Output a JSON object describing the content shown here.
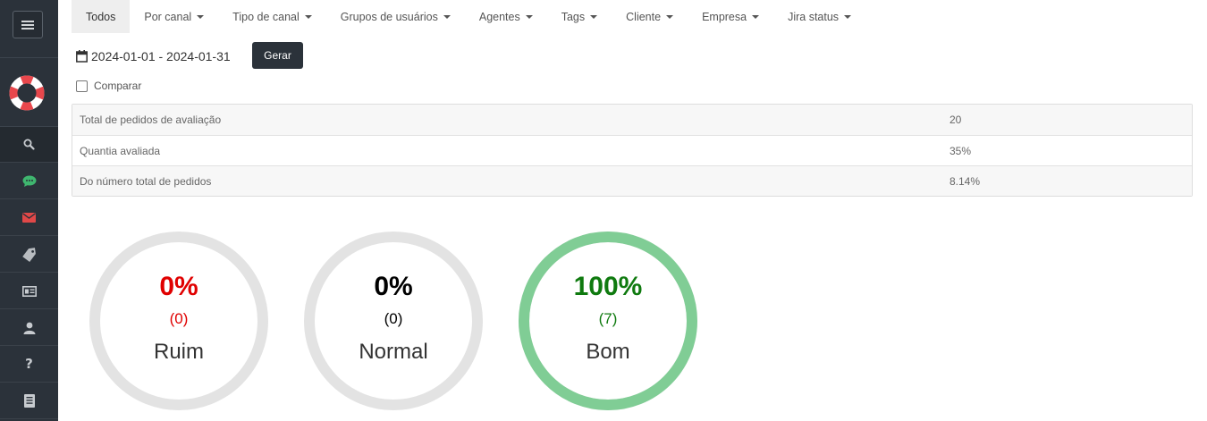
{
  "tabs": [
    {
      "label": "Todos",
      "active": true,
      "dropdown": false
    },
    {
      "label": "Por canal",
      "dropdown": true
    },
    {
      "label": "Tipo de canal",
      "dropdown": true
    },
    {
      "label": "Grupos de usuários",
      "dropdown": true
    },
    {
      "label": "Agentes",
      "dropdown": true
    },
    {
      "label": "Tags",
      "dropdown": true
    },
    {
      "label": "Cliente",
      "dropdown": true
    },
    {
      "label": "Empresa",
      "dropdown": true
    },
    {
      "label": "Jira status",
      "dropdown": true
    }
  ],
  "filter": {
    "date_range": "2024-01-01 - 2024-01-31",
    "generate_label": "Gerar",
    "compare_label": "Comparar",
    "compare_checked": false
  },
  "stats": [
    {
      "label": "Total de pedidos de avaliação",
      "value": "20"
    },
    {
      "label": "Quantia avaliada",
      "value": "35%"
    },
    {
      "label": "Do número total de pedidos",
      "value": "8.14%"
    }
  ],
  "ratings": [
    {
      "percent_text": "0%",
      "count_text": "(0)",
      "label": "Ruim",
      "fraction": 0,
      "text_color": "#e00000"
    },
    {
      "percent_text": "0%",
      "count_text": "(0)",
      "label": "Normal",
      "fraction": 0,
      "text_color": "#000000"
    },
    {
      "percent_text": "100%",
      "count_text": "(7)",
      "label": "Bom",
      "fraction": 1,
      "text_color": "#0f7a0f"
    }
  ],
  "colors": {
    "ring_track": "#e3e3e3",
    "ring_fill_good": "#80cd95",
    "sidebar_bg": "#2b323a",
    "chat_icon": "#3fb66f",
    "mail_icon": "#e04848",
    "logo_red": "#e8474c"
  },
  "sidebar_icons": [
    "menu-icon",
    "lifebuoy-logo",
    "search-icon",
    "chat-icon",
    "mail-icon",
    "tag-icon",
    "id-card-icon",
    "user-icon",
    "question-icon",
    "document-icon"
  ]
}
